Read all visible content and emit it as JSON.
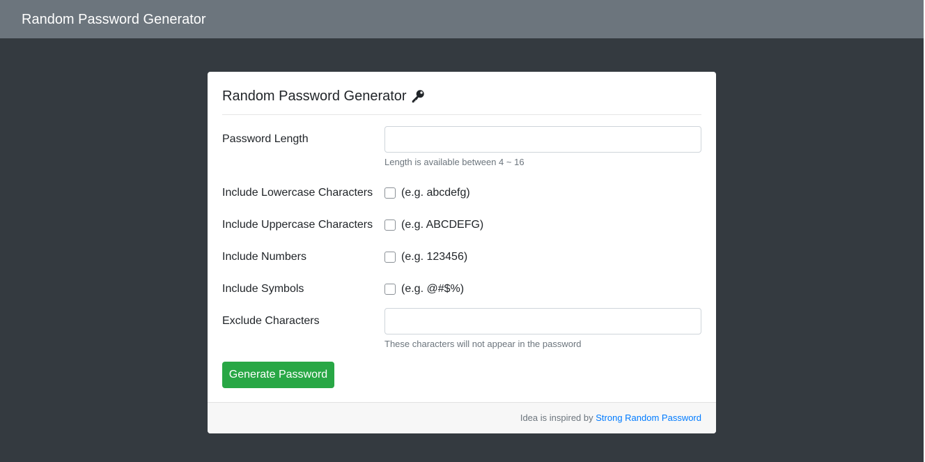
{
  "navbar": {
    "brand": "Random Password Generator"
  },
  "card": {
    "title": "Random Password Generator",
    "title_icon": "key-icon",
    "fields": {
      "length": {
        "label": "Password Length",
        "value": "",
        "placeholder": "",
        "help": "Length is available between 4 ~ 16"
      },
      "lowercase": {
        "label": "Include Lowercase Characters",
        "checked": false,
        "example": "(e.g. abcdefg)"
      },
      "uppercase": {
        "label": "Include Uppercase Characters",
        "checked": false,
        "example": "(e.g. ABCDEFG)"
      },
      "numbers": {
        "label": "Include Numbers",
        "checked": false,
        "example": "(e.g. 123456)"
      },
      "symbols": {
        "label": "Include Symbols",
        "checked": false,
        "example": "(e.g. @#$%)"
      },
      "exclude": {
        "label": "Exclude Characters",
        "value": "",
        "placeholder": "",
        "help": "These characters will not appear in the password"
      }
    },
    "generate_button": "Generate Password",
    "footer": {
      "prefix": "Idea is inspired by ",
      "link_text": "Strong Random Password"
    }
  },
  "colors": {
    "page_bg": "#343a40",
    "navbar_bg": "#6c757d",
    "button_bg": "#28a745",
    "link": "#007bff"
  }
}
